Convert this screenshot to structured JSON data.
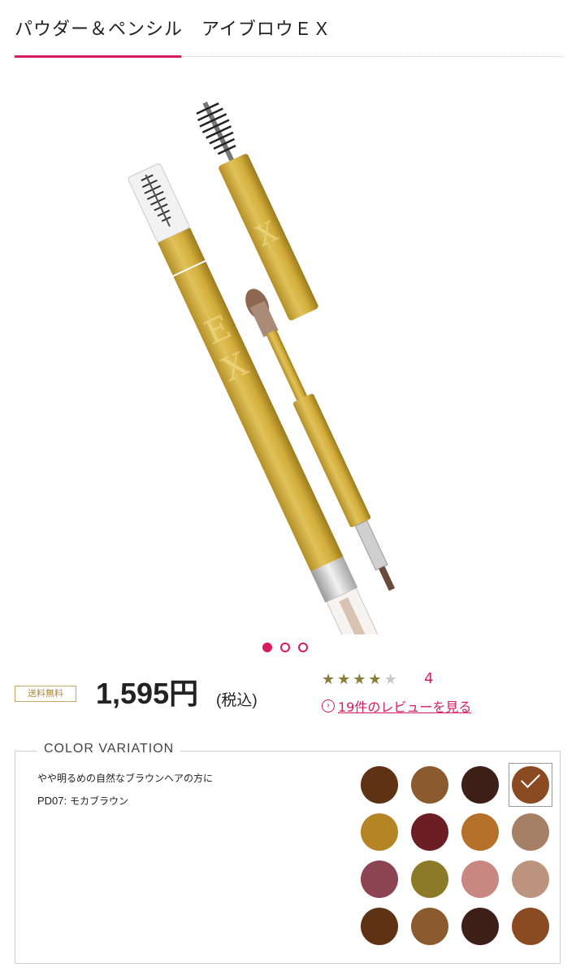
{
  "header": {
    "title": "パウダー＆ペンシル　アイブロウＥＸ"
  },
  "gallery": {
    "dot_count": 3,
    "active_index": 0
  },
  "pricing": {
    "shipping_badge": "送料無料",
    "price": "1,595円",
    "tax_note": "(税込)"
  },
  "rating": {
    "stars": 4,
    "max_stars": 5,
    "value": "4"
  },
  "reviews": {
    "link_label": "19件のレビューを見る"
  },
  "color_variation": {
    "heading": "COLOR VARIATION",
    "description": "やや明るめの自然なブラウンヘアの方に",
    "selected_code": "PD07:",
    "selected_name": " モカブラウン",
    "selected_index": 3,
    "swatches": [
      "#5e3214",
      "#8b5a2e",
      "#3d1f18",
      "#8a4a22",
      "#b58424",
      "#6b1e24",
      "#b5702a",
      "#a58066",
      "#8c4352",
      "#8c7a28",
      "#c98782",
      "#bd957e",
      "#5e3214",
      "#8b5a2e",
      "#3d1f18",
      "#8a4a22"
    ]
  },
  "colors": {
    "accent": "#d81b60",
    "gold": "#c9a961",
    "star": "#8a7d38"
  }
}
